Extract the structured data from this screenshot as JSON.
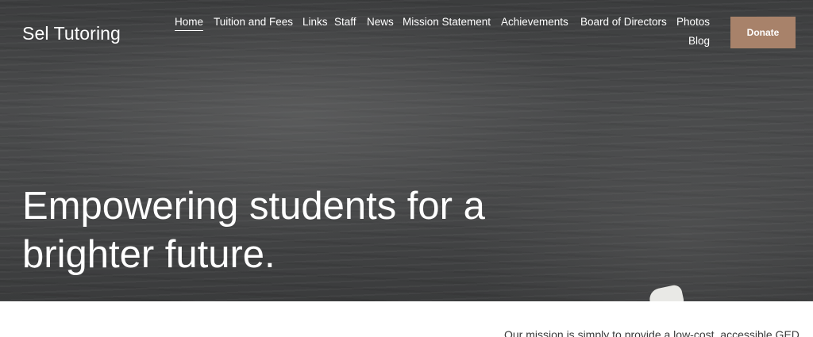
{
  "site": {
    "logo": "Sel Tutoring"
  },
  "nav": {
    "items": [
      {
        "label": "Home",
        "active": true
      },
      {
        "label": "Tuition and Fees"
      },
      {
        "label": "Links"
      },
      {
        "label": "Staff"
      },
      {
        "label": "News"
      },
      {
        "label": "Mission Statement"
      },
      {
        "label": "Achievements"
      },
      {
        "label": "Board of Directors"
      },
      {
        "label": "Photos"
      },
      {
        "label": "Blog"
      }
    ],
    "donate_label": "Donate"
  },
  "hero": {
    "line1": "Empowering students for a",
    "line2": "brighter future."
  },
  "content": {
    "mission_text": "Our mission is simply to provide a low-cost, accessible GED"
  },
  "colors": {
    "donate_bg": "#a8826a",
    "hero_bg": "#444546",
    "text_light": "#ffffff"
  }
}
